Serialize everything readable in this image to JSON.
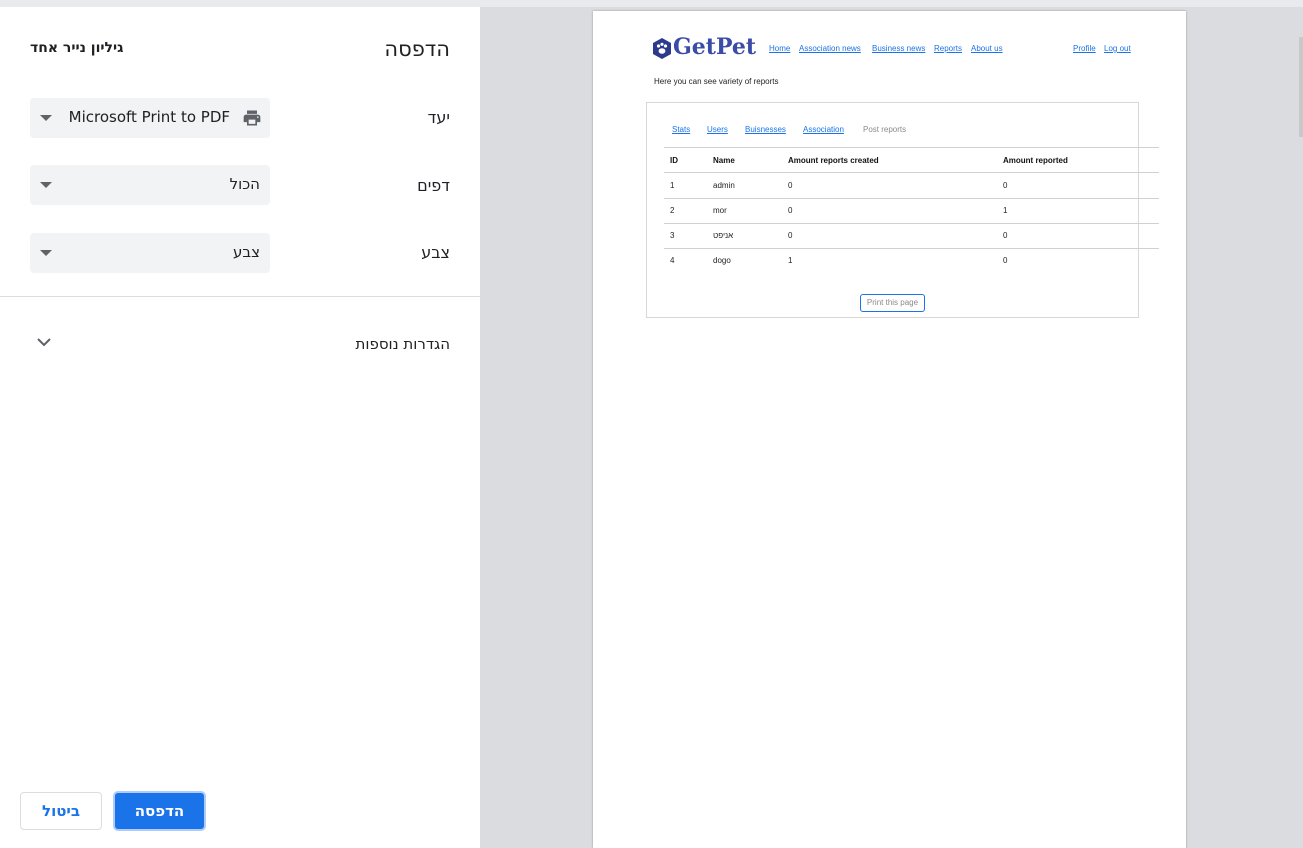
{
  "print_panel": {
    "title": "הדפסה",
    "sheet_count": "גיליון נייר אחד",
    "destination": {
      "label": "יעד",
      "value": "Microsoft Print to PDF",
      "icon": "printer-icon"
    },
    "pages": {
      "label": "דפים",
      "value": "הכול"
    },
    "color": {
      "label": "צבע",
      "value": "צבע"
    },
    "more_settings": "הגדרות נוספות",
    "cancel_label": "ביטול",
    "print_label": "הדפסה",
    "accent_color": "#1a73e8"
  },
  "preview_page": {
    "brand": "GetPet",
    "nav": [
      "Home",
      "Association news",
      "Business news",
      "Reports",
      "About us"
    ],
    "user_links": [
      "Profile",
      "Log out"
    ],
    "intro": "Here you can see variety of reports",
    "tabs": [
      "Stats",
      "Users",
      "Buisnesses",
      "Association",
      "Post reports"
    ],
    "table": {
      "headers": [
        "ID",
        "Name",
        "Amount reports created",
        "Amount reported"
      ],
      "rows": [
        [
          "1",
          "admin",
          "0",
          "0"
        ],
        [
          "2",
          "mor",
          "0",
          "1"
        ],
        [
          "3",
          "אניפט",
          "0",
          "0"
        ],
        [
          "4",
          "dogo",
          "1",
          "0"
        ]
      ]
    },
    "print_button": "Print this page"
  }
}
